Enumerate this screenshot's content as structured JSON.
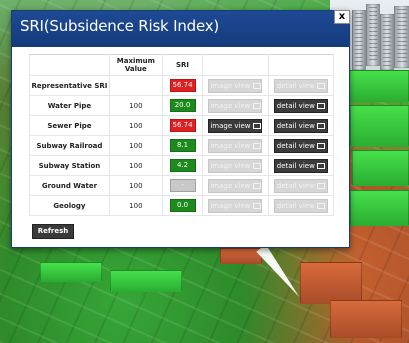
{
  "dialog": {
    "title": "SRI(Subsidence Risk Index)",
    "close_label": "x",
    "columns": {
      "item": "",
      "max": "Maximum Value",
      "sri": "SRI",
      "image": "",
      "detail": ""
    },
    "rows": [
      {
        "label": "Representative SRI",
        "max": "",
        "sri": "56.74",
        "sri_color": "#e02020",
        "image_label": "image view",
        "image_enabled": false,
        "detail_label": "detail view",
        "detail_enabled": false
      },
      {
        "label": "Water Pipe",
        "max": "100",
        "sri": "20.0",
        "sri_color": "#1c8a1c",
        "image_label": "image view",
        "image_enabled": false,
        "detail_label": "detail view",
        "detail_enabled": true
      },
      {
        "label": "Sewer Pipe",
        "max": "100",
        "sri": "56.74",
        "sri_color": "#e02020",
        "image_label": "image view",
        "image_enabled": true,
        "detail_label": "detail view",
        "detail_enabled": true
      },
      {
        "label": "Subway Railroad",
        "max": "100",
        "sri": "8.1",
        "sri_color": "#1c8a1c",
        "image_label": "image view",
        "image_enabled": false,
        "detail_label": "detail view",
        "detail_enabled": true
      },
      {
        "label": "Subway Station",
        "max": "100",
        "sri": "4.2",
        "sri_color": "#1c8a1c",
        "image_label": "image view",
        "image_enabled": false,
        "detail_label": "detail view",
        "detail_enabled": true
      },
      {
        "label": "Ground Water",
        "max": "100",
        "sri": "-",
        "sri_color": "#c8c8c8",
        "image_label": "image view",
        "image_enabled": false,
        "detail_label": "detail view",
        "detail_enabled": false
      },
      {
        "label": "Geology",
        "max": "100",
        "sri": "0.0",
        "sri_color": "#1c8a1c",
        "image_label": "image view",
        "image_enabled": false,
        "detail_label": "detail view",
        "detail_enabled": false
      }
    ],
    "refresh_label": "Refresh"
  },
  "icons": {
    "close": "close-icon",
    "image": "image-icon",
    "detail": "detail-icon"
  }
}
